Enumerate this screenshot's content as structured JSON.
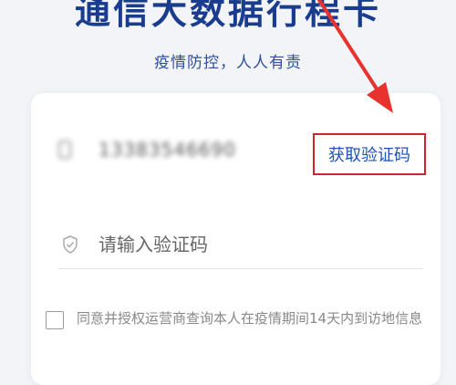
{
  "header": {
    "title": "通信大数据行程卡",
    "subtitle": "疫情防控，人人有责"
  },
  "form": {
    "phone_value": "13383546690",
    "get_code_label": "获取验证码",
    "code_placeholder": "请输入验证码",
    "code_value": "",
    "agreement_checked": false,
    "agreement_text": "同意并授权运营商查询本人在疫情期间14天内到访地信息"
  },
  "annotation": {
    "arrow_color": "#e8322d",
    "highlight_color": "#d0242c"
  },
  "colors": {
    "title": "#1a3c8f",
    "link": "#1f53b8",
    "background": "#f3f4f7"
  },
  "icons": [
    "phone-icon",
    "shield-icon",
    "checkbox-icon"
  ]
}
